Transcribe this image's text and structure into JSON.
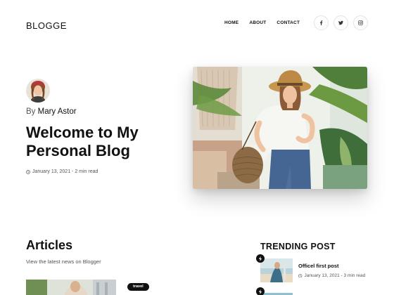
{
  "header": {
    "logo": "BLOGGE",
    "nav": [
      "HOME",
      "ABOUT",
      "CONTACT"
    ],
    "socials": [
      "facebook-icon",
      "twitter-icon",
      "instagram-icon"
    ]
  },
  "hero": {
    "by_prefix": "By",
    "author": "Mary Astor",
    "title": "Welcome to My Personal Blog",
    "meta": "January 13, 2021 - 2 min read"
  },
  "articles": {
    "title": "Articles",
    "subtitle": "View the latest news on Blogger",
    "items": [
      {
        "tag": "travel"
      }
    ]
  },
  "trending": {
    "title": "TRENDING POST",
    "items": [
      {
        "title": "Officel first post",
        "meta": "January 13, 2021 - 3 min read"
      }
    ]
  },
  "colors": {
    "text": "#111111",
    "muted": "#555555",
    "badge": "#111111",
    "border": "#e3e3e3"
  }
}
